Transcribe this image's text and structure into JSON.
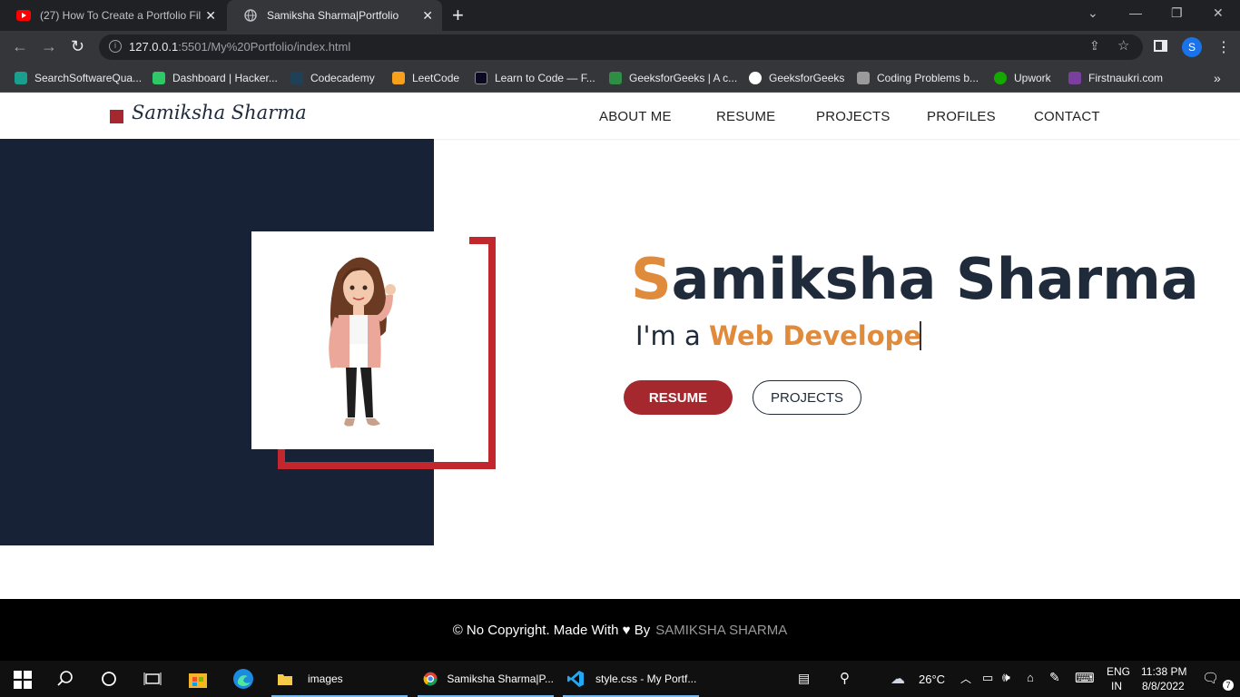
{
  "browser": {
    "tabs": [
      {
        "title": "(27) How To Create a Portfolio Fil",
        "favicon": "youtube-icon"
      },
      {
        "title": "Samiksha Sharma|Portfolio",
        "favicon": "globe-icon"
      }
    ],
    "url_host": "127.0.0.1",
    "url_rest": ":5501/My%20Portfolio/index.html",
    "profile_initial": "S",
    "bookmarks": [
      {
        "label": "SearchSoftwareQua...",
        "color": "#1a9e8e"
      },
      {
        "label": "Dashboard | Hacker...",
        "color": "#2ec866"
      },
      {
        "label": "Codecademy",
        "color": "#1f4056"
      },
      {
        "label": "LeetCode",
        "color": "#f89f1b"
      },
      {
        "label": "Learn to Code — F...",
        "color": "#0a0a23"
      },
      {
        "label": "GeeksforGeeks | A c...",
        "color": "#2f8d46"
      },
      {
        "label": "GeeksforGeeks",
        "color": "#ffffff"
      },
      {
        "label": "Coding Problems b...",
        "color": "#9a9a9a"
      },
      {
        "label": "Upwork",
        "color": "#14a800"
      },
      {
        "label": "Firstnaukri.com",
        "color": "#7b3fa0"
      }
    ],
    "more_bookmarks": "»"
  },
  "site": {
    "logo_text": "Samiksha Sharma",
    "nav": [
      "ABOUT ME",
      "RESUME",
      "PROJECTS",
      "PROFILES",
      "CONTACT"
    ],
    "hero": {
      "name_first_letter": "S",
      "name_rest": "amiksha Sharma",
      "role_prefix": "I'm a",
      "role_typed": "Web Develope"
    },
    "buttons": {
      "resume": "RESUME",
      "projects": "PROJECTS"
    },
    "footer": {
      "text": "© No Copyright. Made With ♥ By",
      "author": "SAMIKSHA SHARMA"
    },
    "colors": {
      "accent": "#e08a3c",
      "brand_red": "#a4282d",
      "dark_panel": "#172236"
    }
  },
  "taskbar": {
    "apps": [
      {
        "label": "images"
      },
      {
        "label": "Samiksha Sharma|P..."
      },
      {
        "label": "style.css - My Portf..."
      }
    ],
    "weather": "26°C",
    "language": "ENG",
    "region": "IN",
    "time": "11:38 PM",
    "date": "8/8/2022",
    "notifications": "7"
  }
}
